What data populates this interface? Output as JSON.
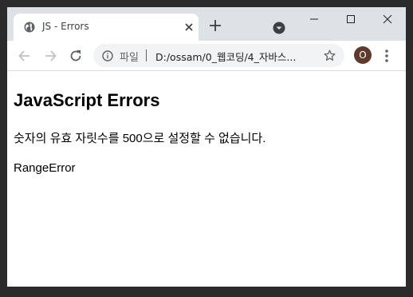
{
  "browser": {
    "tab": {
      "title": "JS - Errors",
      "favicon": "globe-icon"
    },
    "window_controls": [
      "minimize-icon",
      "maximize-icon",
      "close-icon"
    ],
    "toolbar": {
      "back": "back-arrow-icon",
      "forward": "forward-arrow-icon",
      "reload": "reload-icon",
      "scheme_label": "파일",
      "url": "D:/ossam/0_웹코딩/4_자바스...",
      "avatar_letter": "O",
      "avatar_color": "#5d3a2b"
    }
  },
  "page": {
    "heading": "JavaScript Errors",
    "demo1": "숫자의 유효 자릿수를 500으로 설정할 수 없습니다.",
    "demo2": "RangeError"
  },
  "colors": {
    "tabstrip": "#dee1e6",
    "omnibox": "#f1f3f4",
    "icon": "#5f6368"
  }
}
